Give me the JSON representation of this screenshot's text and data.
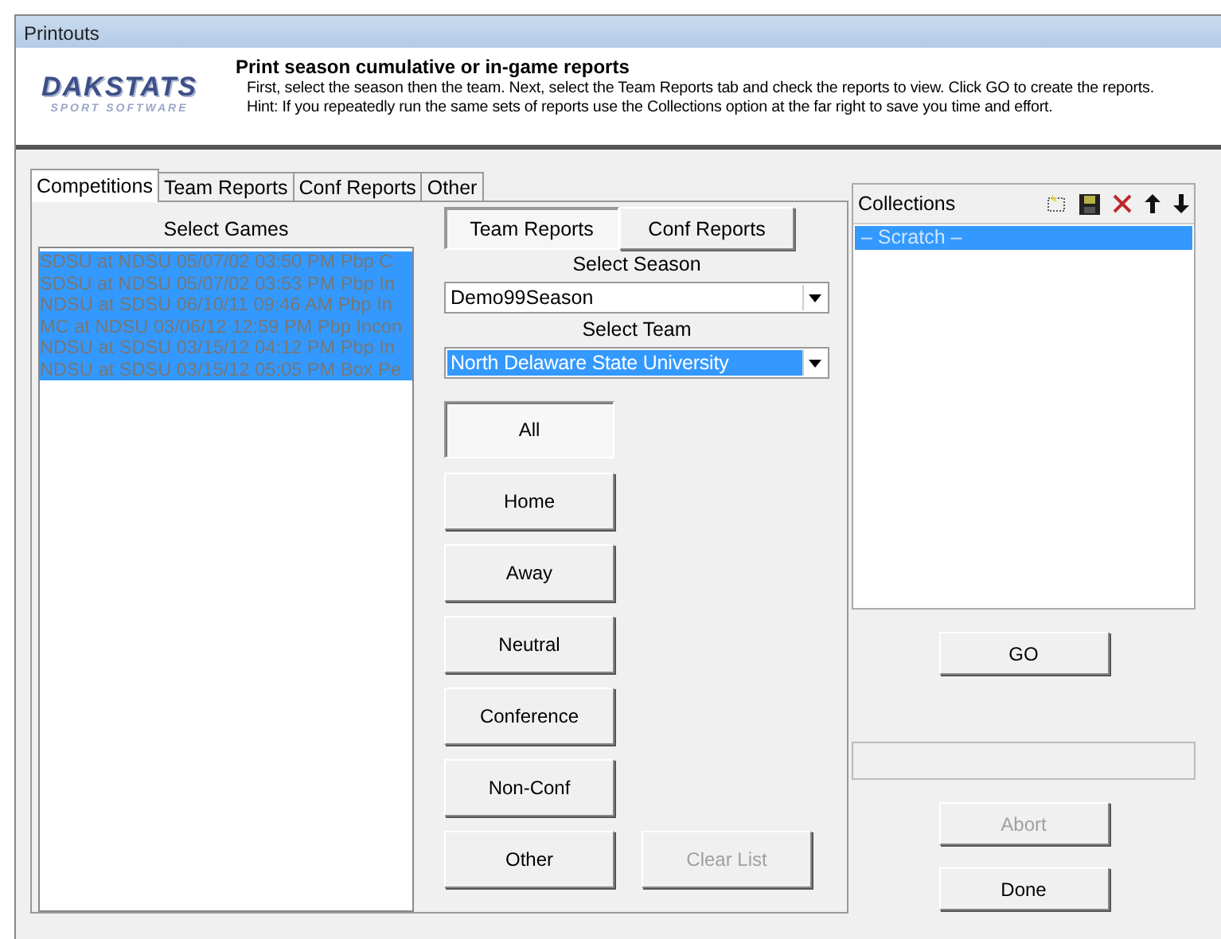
{
  "window": {
    "title": "Printouts"
  },
  "logo": {
    "name": "DAKSTATS",
    "tagline": "SPORT SOFTWARE"
  },
  "header": {
    "heading": "Print season cumulative or in-game reports",
    "line_1": "First, select the season then the team.  Next, select the Team Reports tab and check the reports to view. Click GO to create the reports.",
    "line_2": "Hint: If you repeatedly run the same sets of reports use the Collections option at the far right to save you time and effort."
  },
  "tabs": [
    {
      "label": "Competitions",
      "selected": true
    },
    {
      "label": "Team Reports",
      "selected": false
    },
    {
      "label": "Conf Reports",
      "selected": false
    },
    {
      "label": "Other",
      "selected": false
    }
  ],
  "games": {
    "label": "Select Games",
    "items": [
      {
        "text": "SDSU at NDSU 05/07/02 03:50 PM  Pbp C",
        "selected": true
      },
      {
        "text": "SDSU at NDSU 05/07/02 03:53 PM  Pbp In",
        "selected": true
      },
      {
        "text": "NDSU at SDSU 06/10/11 09:46 AM  Pbp In",
        "selected": true
      },
      {
        "text": "MC at NDSU 03/06/12 12:59 PM  Pbp Incon",
        "selected": true
      },
      {
        "text": "NDSU at SDSU 03/15/12 04:12 PM  Pbp In",
        "selected": true
      },
      {
        "text": "NDSU at SDSU 03/15/12 05:05 PM  Box Pe",
        "selected": true
      }
    ]
  },
  "sub_tabs": [
    {
      "label": "Team Reports",
      "selected": true
    },
    {
      "label": "Conf Reports",
      "selected": false
    }
  ],
  "season": {
    "label": "Select Season",
    "value": "Demo99Season",
    "highlighted": false
  },
  "team": {
    "label": "Select Team",
    "value": "North Delaware State University",
    "highlighted": true
  },
  "filter_buttons": [
    {
      "label": "All",
      "selected": true
    },
    {
      "label": "Home",
      "selected": false
    },
    {
      "label": "Away",
      "selected": false
    },
    {
      "label": "Neutral",
      "selected": false
    },
    {
      "label": "Conference",
      "selected": false
    },
    {
      "label": "Non-Conf",
      "selected": false
    },
    {
      "label": "Other",
      "selected": false
    }
  ],
  "clear_button": {
    "label": "Clear List",
    "disabled": true
  },
  "collections": {
    "title": "Collections",
    "items": [
      {
        "text": "– Scratch –",
        "selected": true
      }
    ]
  },
  "buttons": [
    {
      "label": "GO",
      "disabled": false,
      "kind": "go"
    },
    {
      "label": "Abort",
      "disabled": true,
      "kind": "abort"
    },
    {
      "label": "Done",
      "disabled": false,
      "kind": "done"
    }
  ]
}
